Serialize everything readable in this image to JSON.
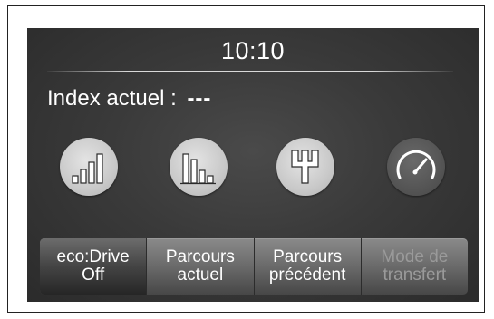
{
  "header": {
    "clock": "10:10"
  },
  "index": {
    "label": "Index actuel :",
    "value": "---"
  },
  "icons": [
    {
      "name": "signal-bars-icon",
      "interactable": true
    },
    {
      "name": "bar-chart-icon",
      "interactable": true
    },
    {
      "name": "gear-shift-icon",
      "interactable": true
    },
    {
      "name": "speedometer-icon",
      "interactable": true
    }
  ],
  "tabs": [
    {
      "line1": "eco:Drive",
      "line2": "Off",
      "state": "active"
    },
    {
      "line1": "Parcours",
      "line2": "actuel",
      "state": "normal"
    },
    {
      "line1": "Parcours",
      "line2": "précédent",
      "state": "normal"
    },
    {
      "line1": "Mode de",
      "line2": "transfert",
      "state": "disabled"
    }
  ],
  "colors": {
    "screen_bg": "#3a3a3a",
    "icon_light": "#cfcfcf",
    "icon_dark": "#555555",
    "text": "#ffffff",
    "text_disabled": "#9a9a9a"
  }
}
